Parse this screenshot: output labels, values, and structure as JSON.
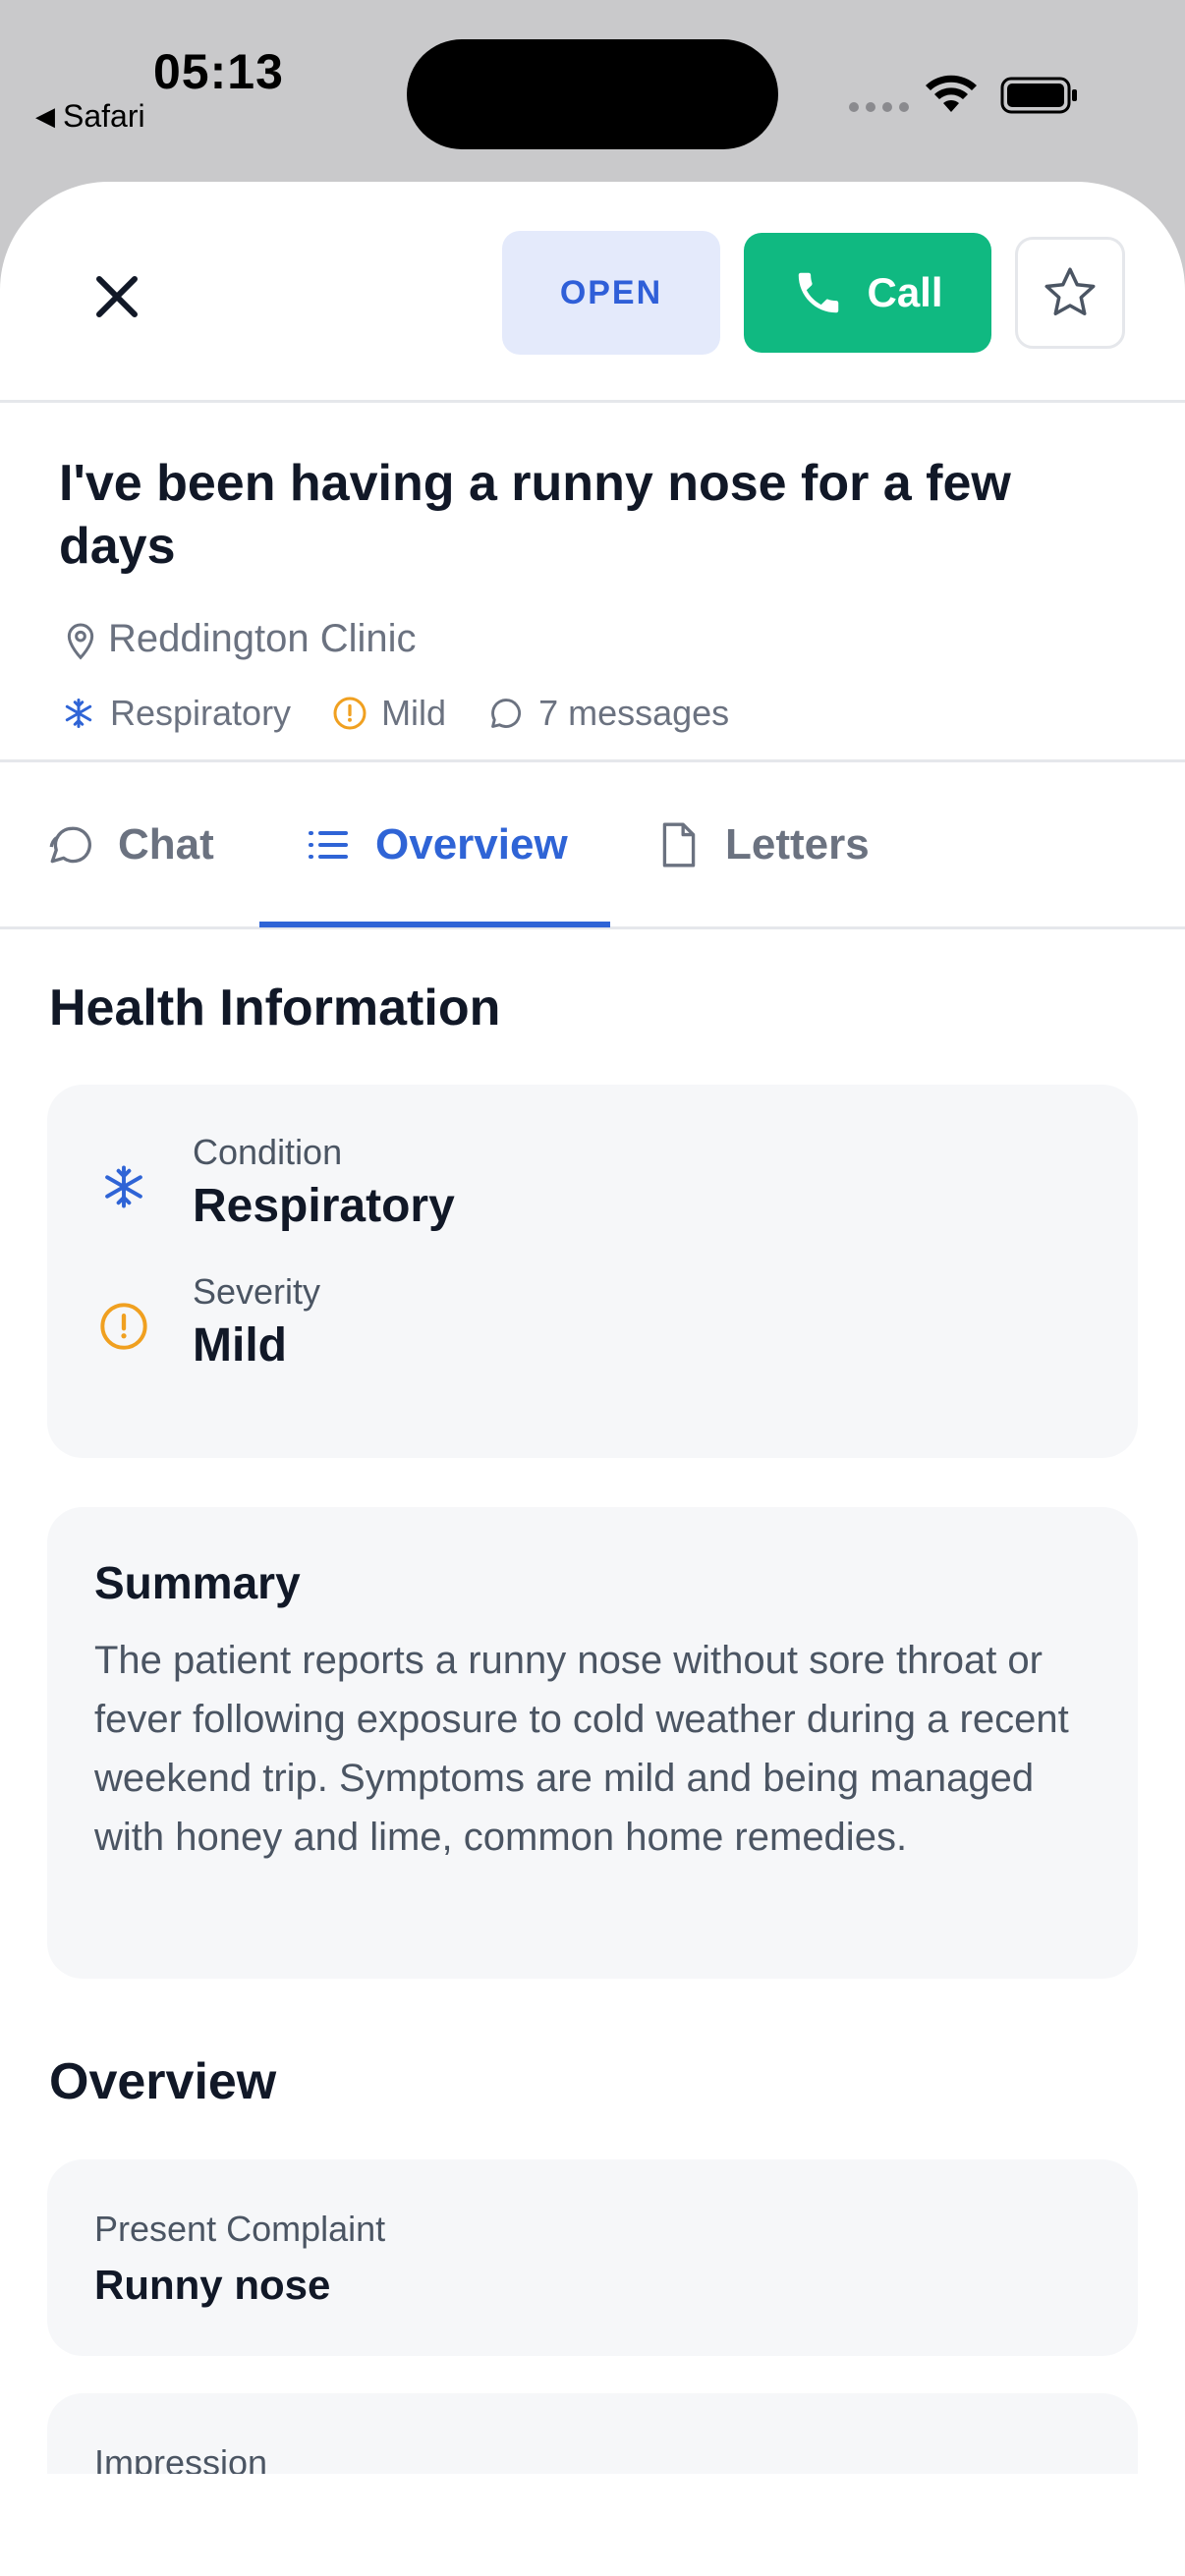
{
  "status_bar": {
    "time": "05:13",
    "back_app": "Safari"
  },
  "header": {
    "status_label": "OPEN",
    "call_label": "Call"
  },
  "case": {
    "title": "I've been having a runny nose for a few days",
    "location": "Reddington Clinic",
    "condition": "Respiratory",
    "severity": "Mild",
    "messages": "7 messages"
  },
  "tabs": [
    {
      "label": "Chat",
      "icon": "chat-bubble-icon"
    },
    {
      "label": "Overview",
      "icon": "list-icon",
      "active": true
    },
    {
      "label": "Letters",
      "icon": "document-icon"
    }
  ],
  "health_info": {
    "heading": "Health Information",
    "condition_label": "Condition",
    "condition_value": "Respiratory",
    "severity_label": "Severity",
    "severity_value": "Mild"
  },
  "summary": {
    "heading": "Summary",
    "text": "The patient reports a runny nose without sore throat or fever following exposure to cold weather during a recent weekend trip. Symptoms are mild and being managed with honey and lime, common home remedies."
  },
  "overview": {
    "heading": "Overview",
    "present_complaint_label": "Present Complaint",
    "present_complaint_value": "Runny nose",
    "impression_label": "Impression"
  },
  "colors": {
    "accent_blue": "#2f64d6",
    "call_green": "#10b981",
    "severity_amber": "#f0a020",
    "pill_bg": "#e4eafb"
  }
}
